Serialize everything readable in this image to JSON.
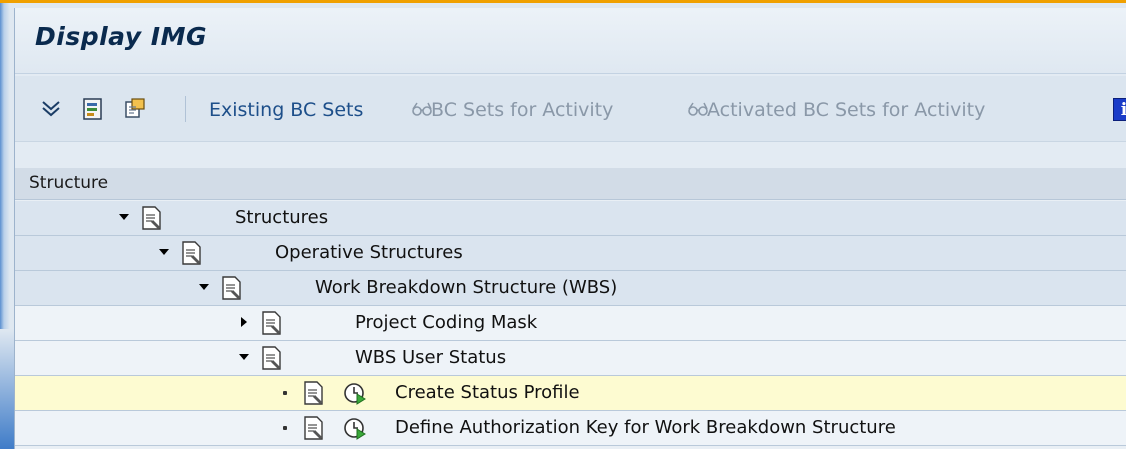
{
  "window": {
    "title": "Display IMG"
  },
  "toolbar": {
    "existing_bc_sets": "Existing BC Sets",
    "bc_sets_for_activity": "BC Sets for Activity",
    "activated_bc_sets": "Activated BC Sets for Activity",
    "info_label": "i"
  },
  "structure": {
    "header": "Structure",
    "rows": [
      {
        "label": "Structures",
        "expanded": true,
        "level": 1
      },
      {
        "label": "Operative Structures",
        "expanded": true,
        "level": 2
      },
      {
        "label": "Work Breakdown Structure (WBS)",
        "expanded": true,
        "level": 3
      },
      {
        "label": "Project Coding Mask",
        "expanded": false,
        "level": 4
      },
      {
        "label": "WBS User Status",
        "expanded": true,
        "level": 4
      },
      {
        "label": "Create Status Profile",
        "activity": true,
        "selected": true,
        "level": 5
      },
      {
        "label": "Define Authorization Key for Work Breakdown Structure",
        "activity": true,
        "level": 5
      }
    ]
  },
  "colors": {
    "accent": "#f0a000",
    "title_text": "#0a2a4e",
    "selected_row": "#fdfbd1",
    "link_text": "#1d4f8a",
    "disabled_text": "#8a98a8"
  },
  "icons": [
    "expand-all-icon",
    "document-settings-icon",
    "display-change-icon",
    "glasses-icon",
    "info-icon",
    "note-document-icon",
    "execute-clock-icon"
  ]
}
